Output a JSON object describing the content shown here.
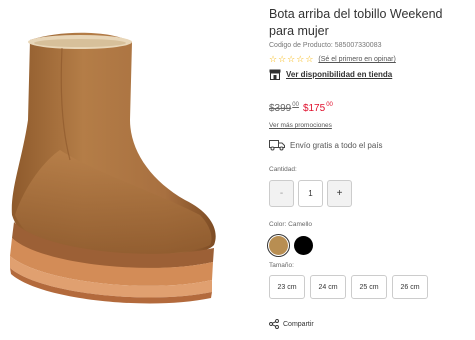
{
  "product": {
    "title": "Bota arriba del tobillo Weekend para mujer",
    "sku": "Codigo de Producto: 585007330083"
  },
  "rating": {
    "stars": 0,
    "review_link": "(Sé el primero en opinar)"
  },
  "store": {
    "availability_link": "Ver disponibilidad en tienda"
  },
  "price": {
    "old_main": "$399",
    "old_cents": "00",
    "new_main": "$175",
    "new_cents": "00"
  },
  "promotions_link": "Ver más promociones",
  "shipping_text": "Envío gratis a todo el país",
  "quantity": {
    "label": "Cantidad:",
    "value": "1",
    "minus": "-",
    "plus": "+"
  },
  "color": {
    "label": "Color: Camello",
    "options": [
      {
        "hex": "#b88e52",
        "selected": true
      },
      {
        "hex": "#000000",
        "selected": false
      }
    ]
  },
  "size": {
    "label": "Tamaño:",
    "options": [
      "23 cm",
      "24 cm",
      "25 cm",
      "26 cm"
    ]
  },
  "share_label": "Compartir",
  "colors": {
    "sale_price": "#e0102d",
    "star": "#f5b301",
    "boot_main": "#b07a45",
    "sole": "#c88b5e"
  }
}
